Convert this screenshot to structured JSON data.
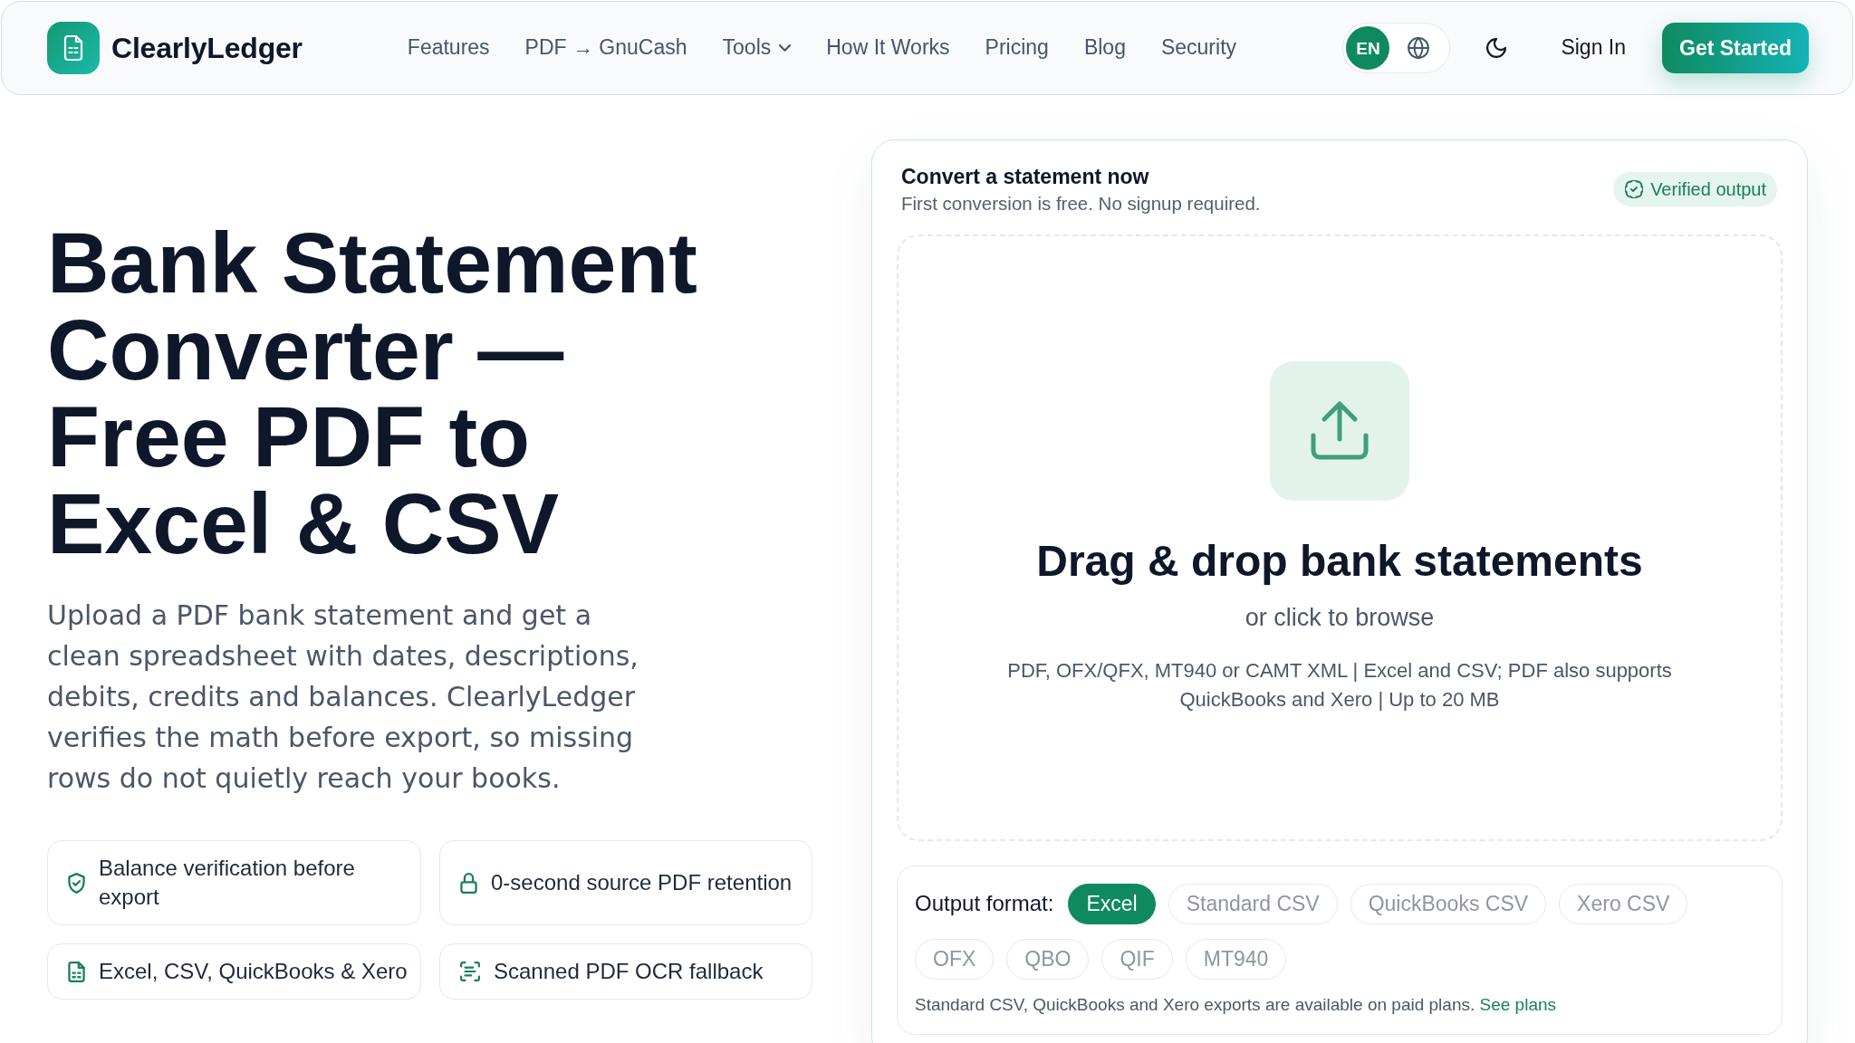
{
  "header": {
    "brand": "ClearlyLedger",
    "nav": [
      {
        "label": "Features",
        "kind": "link"
      },
      {
        "label": "PDF → GnuCash",
        "kind": "link"
      },
      {
        "label": "Tools",
        "kind": "dropdown"
      },
      {
        "label": "How It Works",
        "kind": "link"
      },
      {
        "label": "Pricing",
        "kind": "link"
      },
      {
        "label": "Blog",
        "kind": "link"
      },
      {
        "label": "Security",
        "kind": "link"
      }
    ],
    "language": {
      "label": "EN",
      "selected": true
    },
    "sign_in": "Sign In",
    "cta": "Get Started"
  },
  "hero": {
    "title": "Bank Statement Converter — Free PDF to Excel & CSV",
    "description": "Upload a PDF bank statement and get a clean spreadsheet with dates, descriptions, debits, credits and balances. ClearlyLedger verifies the math before export, so missing rows do not quietly reach your books.",
    "features": [
      "Balance verification before export",
      "0-second source PDF retention",
      "Excel, CSV, QuickBooks & Xero",
      "Scanned PDF OCR fallback"
    ]
  },
  "converter": {
    "title": "Convert a statement now",
    "subtitle": "First conversion is free. No signup required.",
    "badge": "Verified output",
    "dropzone": {
      "heading": "Drag & drop bank statements",
      "subheading": "or click to browse",
      "formats": "PDF, OFX/QFX, MT940 or CAMT XML | Excel and CSV; PDF also supports QuickBooks and Xero | Up to 20 MB"
    },
    "output_format": {
      "label": "Output format:",
      "options": [
        {
          "label": "Excel",
          "selected": true
        },
        {
          "label": "Standard CSV",
          "selected": false
        },
        {
          "label": "QuickBooks CSV",
          "selected": false
        },
        {
          "label": "Xero CSV",
          "selected": false
        },
        {
          "label": "OFX",
          "selected": false
        },
        {
          "label": "QBO",
          "selected": false
        },
        {
          "label": "QIF",
          "selected": false
        },
        {
          "label": "MT940",
          "selected": false
        }
      ],
      "note": "Standard CSV, QuickBooks and Xero exports are available on paid plans.",
      "link": "See plans"
    }
  }
}
